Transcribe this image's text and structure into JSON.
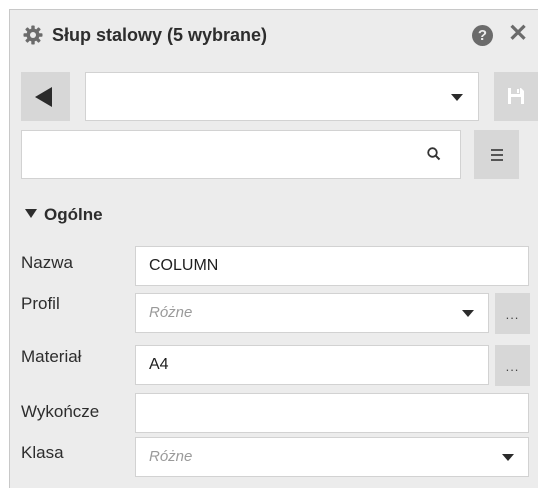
{
  "header": {
    "title": "Słup stalowy (5 wybrane)",
    "help_glyph": "?",
    "close_glyph": "✕"
  },
  "toolbar": {
    "top_select_value": ""
  },
  "search": {
    "value": ""
  },
  "section": {
    "title": "Ogólne"
  },
  "properties": [
    {
      "label": "Nazwa",
      "value": "COLUMN",
      "is_placeholder": false
    },
    {
      "label": "Profil",
      "value": "Różne",
      "is_placeholder": true
    },
    {
      "label": "Materiał",
      "value": "A4",
      "is_placeholder": false
    },
    {
      "label": "Wykończe",
      "value": "",
      "is_placeholder": false
    },
    {
      "label": "Klasa",
      "value": "Różne",
      "is_placeholder": true
    }
  ],
  "icons": {
    "gear": "gear-icon",
    "back": "back-arrow-icon",
    "save": "save-icon",
    "search": "search-icon",
    "menu": "menu-icon",
    "dots": "ellipsis-icon"
  },
  "colors": {
    "panel_bg": "#ececec",
    "button_bg": "#d7d7d7",
    "field_bg": "#ffffff",
    "icon_gray": "#6b6b6b"
  }
}
